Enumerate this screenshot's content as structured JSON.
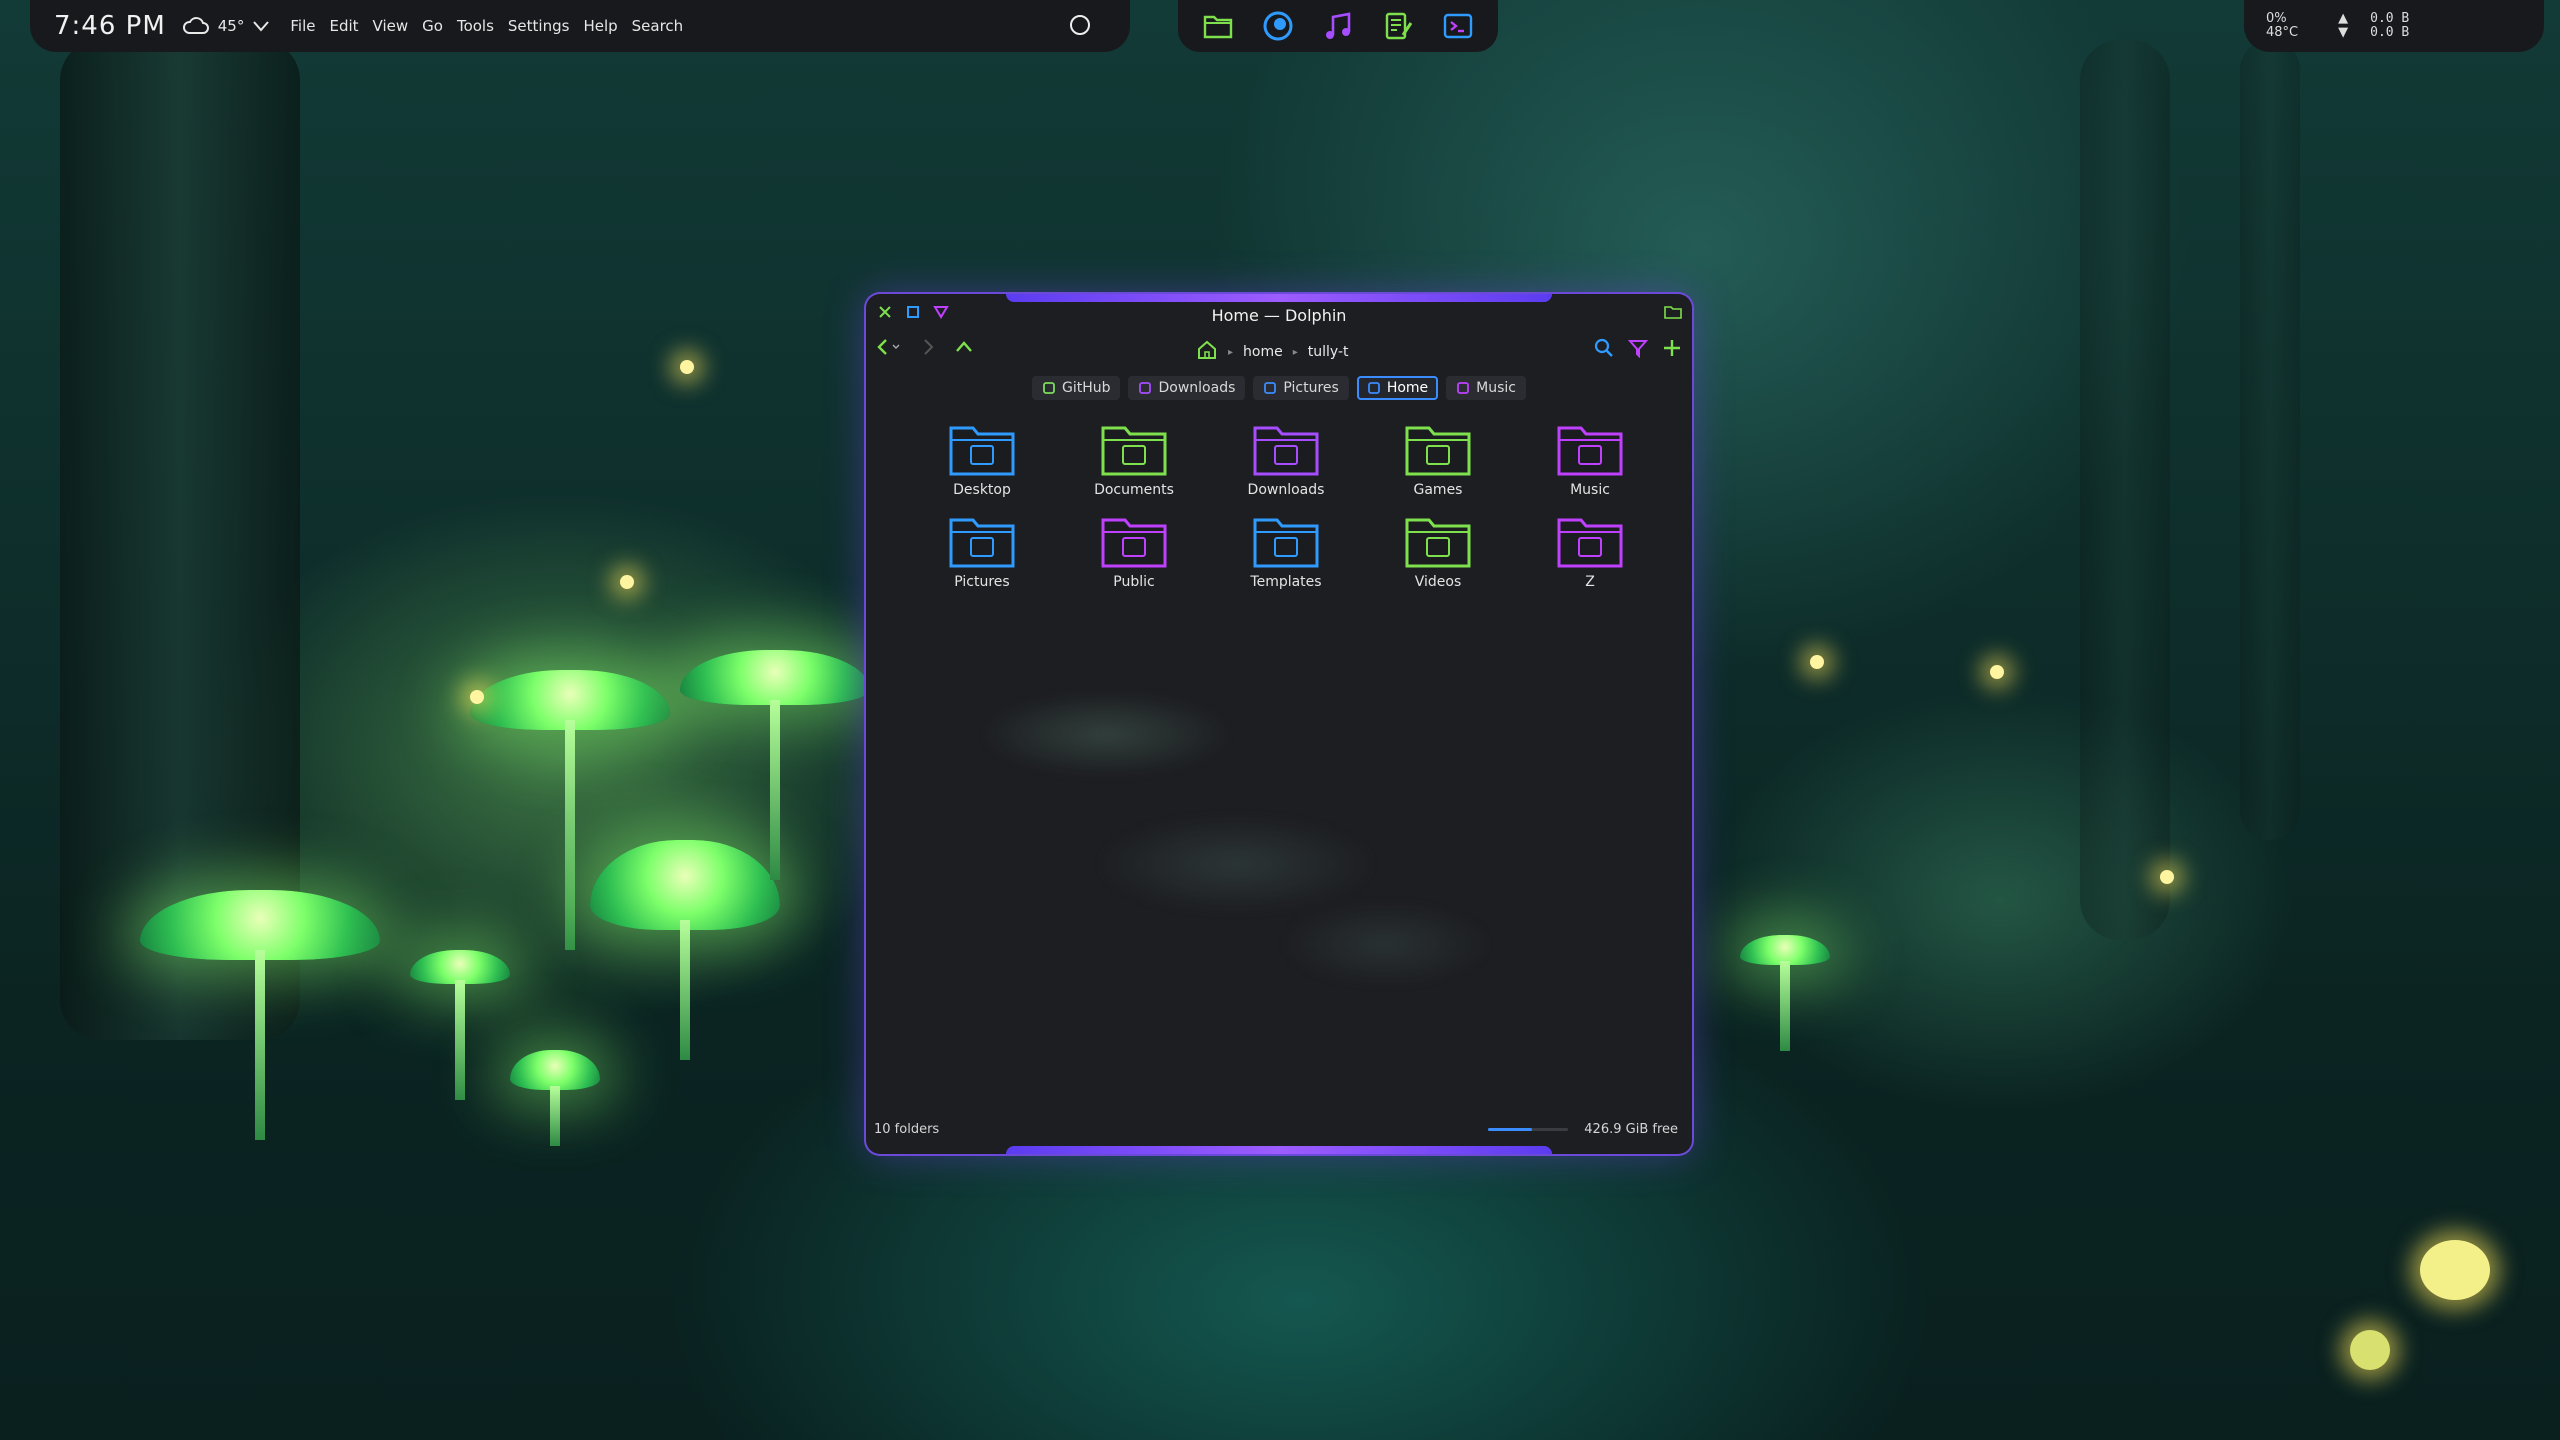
{
  "panel": {
    "clock": "7:46 PM",
    "weather_temp": "45°",
    "menu": [
      "File",
      "Edit",
      "View",
      "Go",
      "Tools",
      "Settings",
      "Help",
      "Search"
    ]
  },
  "dock": {
    "apps": [
      "folder-icon",
      "browser-icon",
      "music-icon",
      "notes-icon",
      "terminal-icon"
    ]
  },
  "tray": {
    "cpu": "0%",
    "temp": "48°C",
    "net_up": "0.0 B",
    "net_down": "0.0 B"
  },
  "window": {
    "title": "Home — Dolphin",
    "breadcrumb": [
      "home",
      "tully-t"
    ],
    "places": [
      {
        "label": "GitHub",
        "color": "#7ddc5a",
        "active": false
      },
      {
        "label": "Downloads",
        "color": "#a64dff",
        "active": false
      },
      {
        "label": "Pictures",
        "color": "#3a8cff",
        "active": false
      },
      {
        "label": "Home",
        "color": "#3a8cff",
        "active": true
      },
      {
        "label": "Music",
        "color": "#c040ff",
        "active": false
      }
    ],
    "folders": [
      {
        "label": "Desktop",
        "color": "#2f9bff"
      },
      {
        "label": "Documents",
        "color": "#7ee04c"
      },
      {
        "label": "Downloads",
        "color": "#a64dff"
      },
      {
        "label": "Games",
        "color": "#7ee04c"
      },
      {
        "label": "Music",
        "color": "#c040ff"
      },
      {
        "label": "Pictures",
        "color": "#2f9bff"
      },
      {
        "label": "Public",
        "color": "#c040ff"
      },
      {
        "label": "Templates",
        "color": "#2f9bff"
      },
      {
        "label": "Videos",
        "color": "#7ee04c"
      },
      {
        "label": "Z",
        "color": "#c040ff"
      }
    ],
    "status_left": "10 folders",
    "status_right": "426.9 GiB free",
    "free_fraction": 0.55
  },
  "colors": {
    "accent_purple": "#6b4ad8",
    "accent_blue": "#3a8cff",
    "accent_green": "#7ee04c"
  }
}
